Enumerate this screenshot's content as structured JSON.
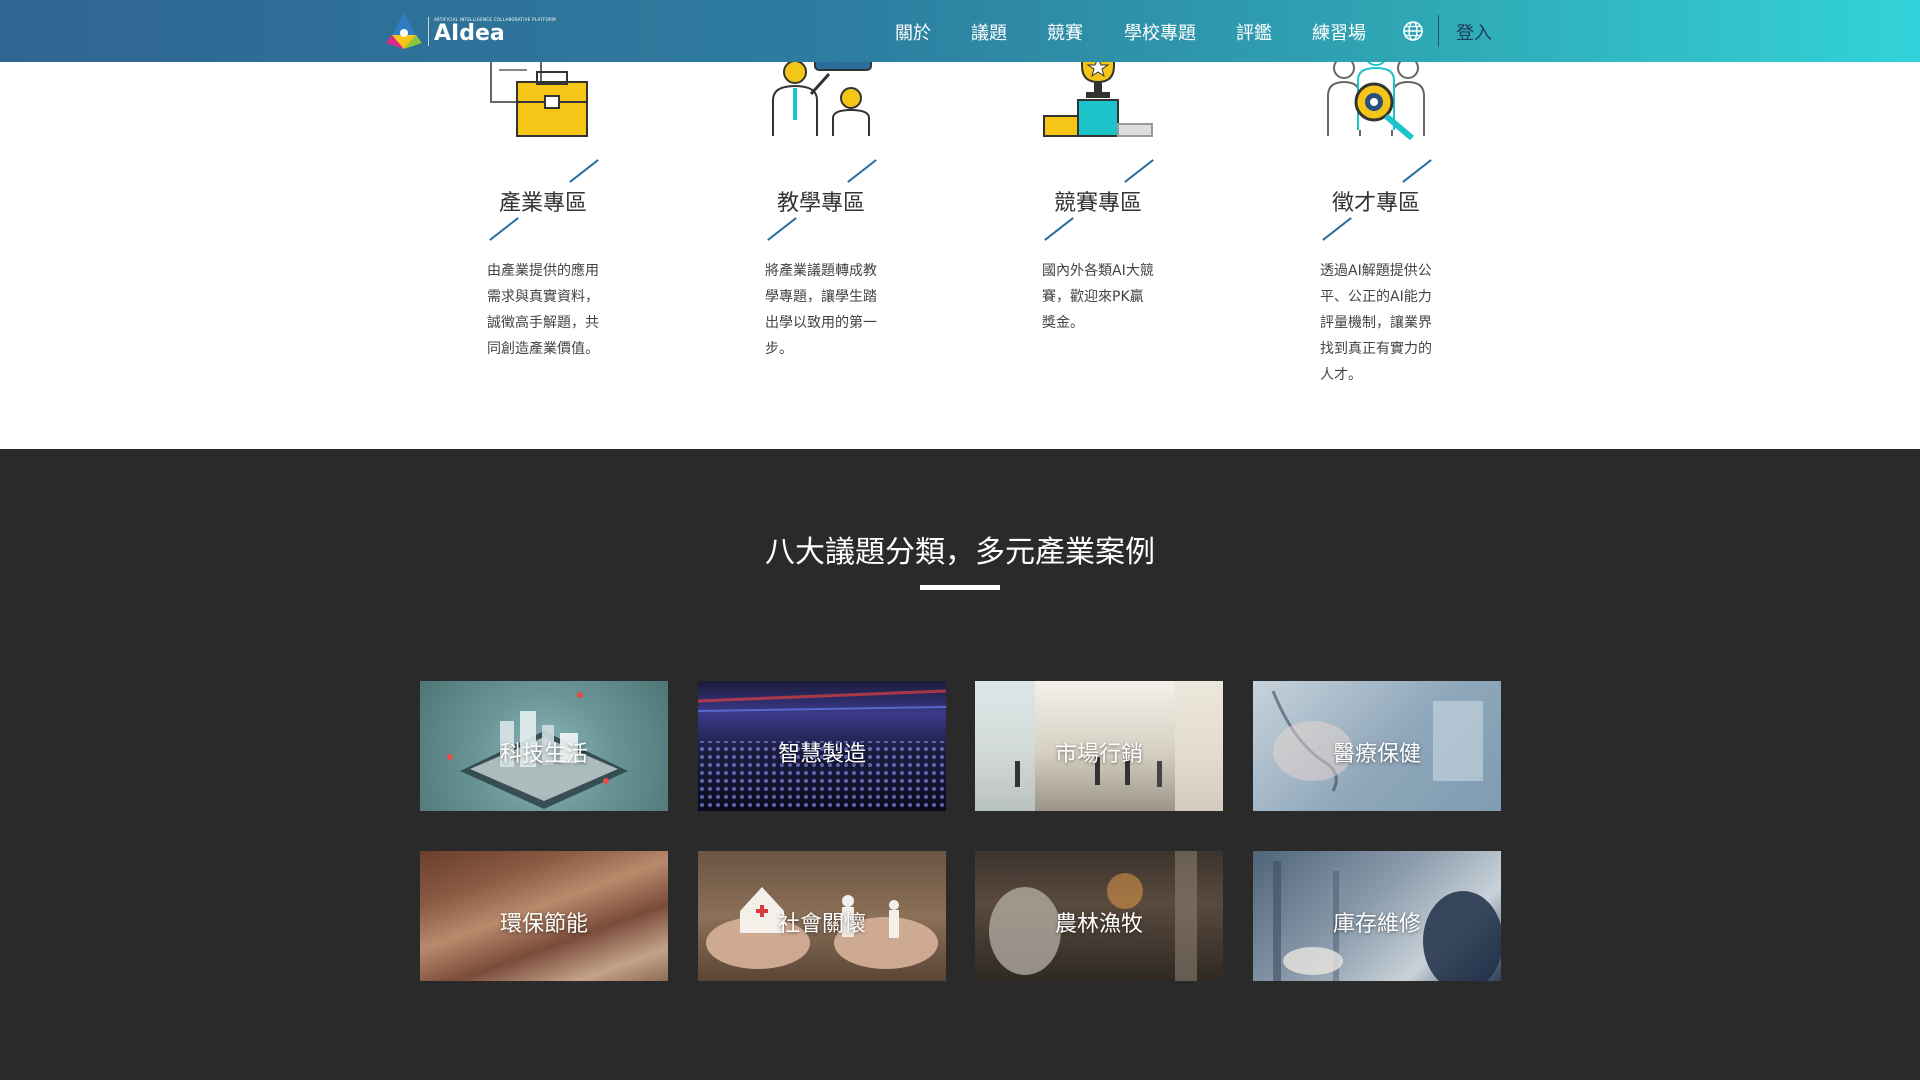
{
  "header": {
    "logo_small_text": "ARTIFICIAL INTELLIGENCE COLLABORATIVE PLATFORM",
    "logo_brand": "AIdea",
    "nav": [
      "關於",
      "議題",
      "競賽",
      "學校專題",
      "評鑑",
      "練習場"
    ],
    "login": "登入",
    "language_icon": "globe-icon"
  },
  "zones": [
    {
      "title": "產業專區",
      "desc": "由產業提供的應用需求與真實資料，誠徵高手解題，共同創造產業價值。",
      "icon": "briefcase-document-icon"
    },
    {
      "title": "教學專區",
      "desc": "將產業議題轉成教學專題，讓學生踏出學以致用的第一步。",
      "icon": "teacher-student-icon"
    },
    {
      "title": "競賽專區",
      "desc": "國內外各類AI大競賽，歡迎來PK贏獎金。",
      "icon": "trophy-podium-icon"
    },
    {
      "title": "徵才專區",
      "desc": "透過AI解題提供公平、公正的AI能力評量機制，讓業界找到真正有實力的人才。",
      "icon": "talent-search-icon"
    }
  ],
  "categories_section": {
    "title": "八大議題分類，多元產業案例",
    "tiles": [
      "科技生活",
      "智慧製造",
      "市場行銷",
      "醫療保健",
      "環保節能",
      "社會關懷",
      "農林漁牧",
      "庫存維修"
    ]
  },
  "colors": {
    "header_start": "#2f6591",
    "header_end": "#33d3da",
    "dark_bg": "#2a2a2a",
    "accent_blue": "#2b6e9e",
    "accent_yellow": "#f5c518",
    "accent_teal": "#1cc3c9"
  }
}
